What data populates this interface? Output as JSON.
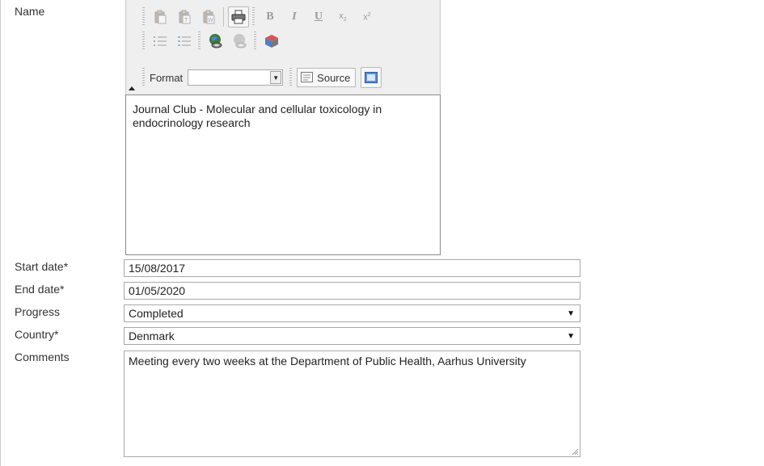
{
  "labels": {
    "name": "Name",
    "start_date": "Start date*",
    "end_date": "End date*",
    "progress": "Progress",
    "country": "Country*",
    "comments": "Comments"
  },
  "toolbar": {
    "bold": "B",
    "italic": "I",
    "underline": "U",
    "subscript": "x",
    "subscript_mark": "2",
    "superscript": "x",
    "superscript_mark": "2",
    "format_label": "Format",
    "format_value": "",
    "source_label": "Source",
    "icons": [
      "paste-icon",
      "paste-text-icon",
      "paste-word-icon",
      "print-icon",
      "bold-icon",
      "italic-icon",
      "underline-icon",
      "subscript-icon",
      "superscript-icon",
      "numbered-list-icon",
      "bulleted-list-icon",
      "link-icon",
      "unlink-icon",
      "image-icon",
      "source-icon",
      "maximize-icon"
    ]
  },
  "editor": {
    "content": "Journal Club - Molecular and cellular toxicology in endocrinology research"
  },
  "fields": {
    "start_date": "15/08/2017",
    "end_date": "01/05/2020",
    "progress": "Completed",
    "country": "Denmark",
    "comments": "Meeting every two weeks at the Department of Public Health, Aarhus University"
  },
  "colors": {
    "toolbar_bg": "#efefef",
    "border": "#a9a9a9",
    "text": "#222222"
  }
}
